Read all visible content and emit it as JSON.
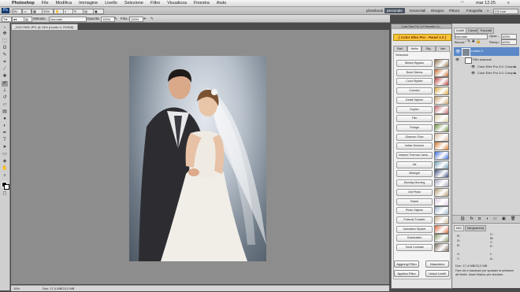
{
  "menubar": {
    "app": "Photoshop",
    "items": [
      "File",
      "Modifica",
      "Immagine",
      "Livello",
      "Selezione",
      "Filtro",
      "Visualizza",
      "Finestra",
      "Aiuto"
    ],
    "clock": "mar 12:25",
    "user": "CS Live"
  },
  "appbar": {
    "zoom": "33%",
    "workspaces": [
      "photobook",
      "personale",
      "Essenziali",
      "Disegno",
      "Pittura",
      "Fotografia"
    ],
    "active_workspace": "personale"
  },
  "options": {
    "mode_label": "Metodo:",
    "mode_value": "Normale",
    "opacity_label": "Opacità:",
    "opacity_value": "100%",
    "flow_label": "Flus.:",
    "flow_value": "100%"
  },
  "document": {
    "tab": "_DSC7595.JPG @ 15% (Livello 0, RGB/8)",
    "status_zoom": "15%",
    "status_doc": "Doc: 17,4 MB/23,2 MB"
  },
  "plugin": {
    "window_title": "Color Efex Pro 3.0 Pannello Co...",
    "banner": "[ Color Efex Pro - Panel 1.0 ]",
    "tabs": [
      "Ball.",
      "Nella",
      "Sfg.",
      "Vari"
    ],
    "active_tab": "Nella",
    "list_label": "Selezioni",
    "filters": [
      {
        "name": "Bleach Bypass",
        "thumb": "#8a6a4a"
      },
      {
        "name": "Burnt Sienna",
        "thumb": "#c0662b"
      },
      {
        "name": "Color Stylizer",
        "thumb": "#b63a3a"
      },
      {
        "name": "Colorize",
        "thumb": "#d4a43a"
      },
      {
        "name": "Detail Stylizer",
        "thumb": "#c8a06a"
      },
      {
        "name": "Duplex",
        "thumb": "#c86a6a"
      },
      {
        "name": "Film",
        "thumb": "#d8cfa0"
      },
      {
        "name": "Foliage",
        "thumb": "#6a8a3a"
      },
      {
        "name": "Glamour Glow",
        "thumb": "#d8b8a0"
      },
      {
        "name": "Indian Summer",
        "thumb": "#d87a2a"
      },
      {
        "name": "Infrared Thermal Came...",
        "thumb": "#3a6ad8"
      },
      {
        "name": "Ink",
        "thumb": "#6a9ab0"
      },
      {
        "name": "Midnight",
        "thumb": "#3a4a7a"
      },
      {
        "name": "Monday Morning",
        "thumb": "#a0a0b8"
      },
      {
        "name": "Old Photo",
        "thumb": "#b0946a"
      },
      {
        "name": "Pastel",
        "thumb": "#d8c8e0"
      },
      {
        "name": "Photo Stylizer",
        "thumb": "#9ab0c8"
      },
      {
        "name": "Polaroid Transfer",
        "thumb": "#c8b08a"
      },
      {
        "name": "Saturation Stylizer",
        "thumb": "#d86a3a"
      },
      {
        "name": "Solarization",
        "thumb": "#8a9a6a"
      },
      {
        "name": "Tonal Contrast",
        "thumb": "#7a6a5a"
      }
    ],
    "add_filters": "Aggiungi Filtro",
    "mask": "Maschera",
    "apply_filter": "Applica Filtro",
    "merge_layers": "Unisci Livelli"
  },
  "layers": {
    "tabs": [
      "Livelli",
      "Canali",
      "Tracciati"
    ],
    "active_tab": "Livelli",
    "blend": "Normale",
    "opacity_label": "Opac.:",
    "opacity": "100%",
    "fill_label": "Riemp.:",
    "fill": "100%",
    "lock_label": "Blocca:",
    "layer_name": "Livello 0",
    "smart_filters": "Filtri avanzati",
    "filter1": "Color Efex Pro 3.0: Compl...",
    "filter2": "Color Efex Pro 3.0: Compl..."
  },
  "info": {
    "tabs": [
      "Info",
      "Istogramma"
    ],
    "r": "R:",
    "g": "G:",
    "b": "B:",
    "c": "C:",
    "m": "M:",
    "y": "Y:",
    "k": "K:",
    "x": "X:",
    "y2": "Y:",
    "l": "L:",
    "a": "A:",
    "doc": "Doc: 17,4 MB/23,2 MB",
    "hint": "Fare clic e trascinare per spostare la selezione del livello. Usare Maiusc per vincolare."
  },
  "colors": {
    "accent": "#4b5563",
    "banner": "#f7c53a",
    "selected_layer": "#5a88c8"
  }
}
